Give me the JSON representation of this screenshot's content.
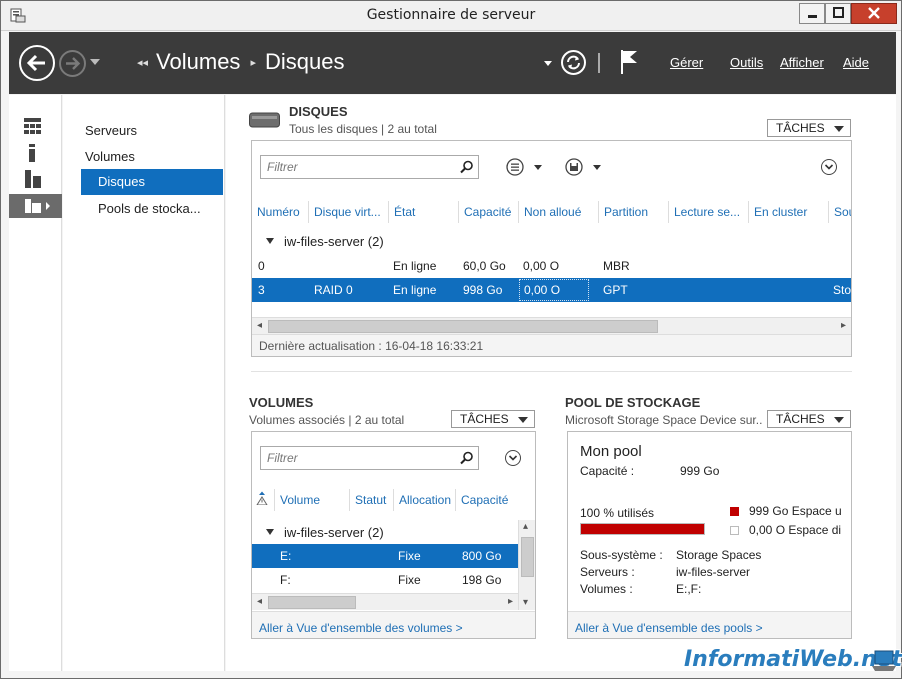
{
  "window": {
    "title": "Gestionnaire de serveur"
  },
  "header": {
    "breadcrumb": [
      "Volumes",
      "Disques"
    ],
    "menu": {
      "manage": "Gérer",
      "tools": "Outils",
      "view": "Afficher",
      "help": "Aide"
    }
  },
  "nav": {
    "items": [
      {
        "label": "Serveurs"
      },
      {
        "label": "Volumes"
      },
      {
        "label": "Disques",
        "selected": true
      },
      {
        "label": "Pools de stocka..."
      }
    ]
  },
  "disks": {
    "title": "DISQUES",
    "subtitle": "Tous les disques | 2 au total",
    "tasks_label": "TÂCHES",
    "filter_placeholder": "Filtrer",
    "columns": [
      "Numéro",
      "Disque virt...",
      "État",
      "Capacité",
      "Non alloué",
      "Partition",
      "Lecture se...",
      "En cluster",
      "Sou"
    ],
    "group": "iw-files-server (2)",
    "rows": [
      {
        "num": "0",
        "virt": "",
        "state": "En ligne",
        "capacity": "60,0 Go",
        "unalloc": "0,00 O",
        "partition": "MBR",
        "source": ""
      },
      {
        "num": "3",
        "virt": "RAID 0",
        "state": "En ligne",
        "capacity": "998 Go",
        "unalloc": "0,00 O",
        "partition": "GPT",
        "source": "Sto"
      }
    ],
    "status": "Dernière actualisation : 16-04-18 16:33:21"
  },
  "volumes": {
    "title": "VOLUMES",
    "subtitle": "Volumes associés | 2 au total",
    "tasks_label": "TÂCHES",
    "filter_placeholder": "Filtrer",
    "columns": [
      "Volume",
      "Statut",
      "Allocation",
      "Capacité"
    ],
    "group": "iw-files-server (2)",
    "rows": [
      {
        "volume": "E:",
        "allocation": "Fixe",
        "capacity": "800 Go"
      },
      {
        "volume": "F:",
        "allocation": "Fixe",
        "capacity": "198 Go"
      }
    ],
    "link": "Aller à Vue d'ensemble des volumes >"
  },
  "pool": {
    "title": "POOL DE STOCKAGE",
    "subtitle": "Microsoft Storage Space Device sur...",
    "tasks_label": "TÂCHES",
    "name": "Mon pool",
    "capacity_label": "Capacité :",
    "capacity_value": "999 Go",
    "used_text": "100 % utilisés",
    "used_fraction": 1.0,
    "legend_used": "999 Go Espace u",
    "legend_free": "0,00 O Espace di",
    "used_color": "#c00000",
    "subsystem_label": "Sous-système :",
    "subsystem_value": "Storage Spaces",
    "servers_label": "Serveurs :",
    "servers_value": "iw-files-server",
    "volumes_label": "Volumes :",
    "volumes_value": "E:,F:",
    "link": "Aller à Vue d'ensemble des pools >"
  },
  "watermark": "InformatiWeb.net"
}
